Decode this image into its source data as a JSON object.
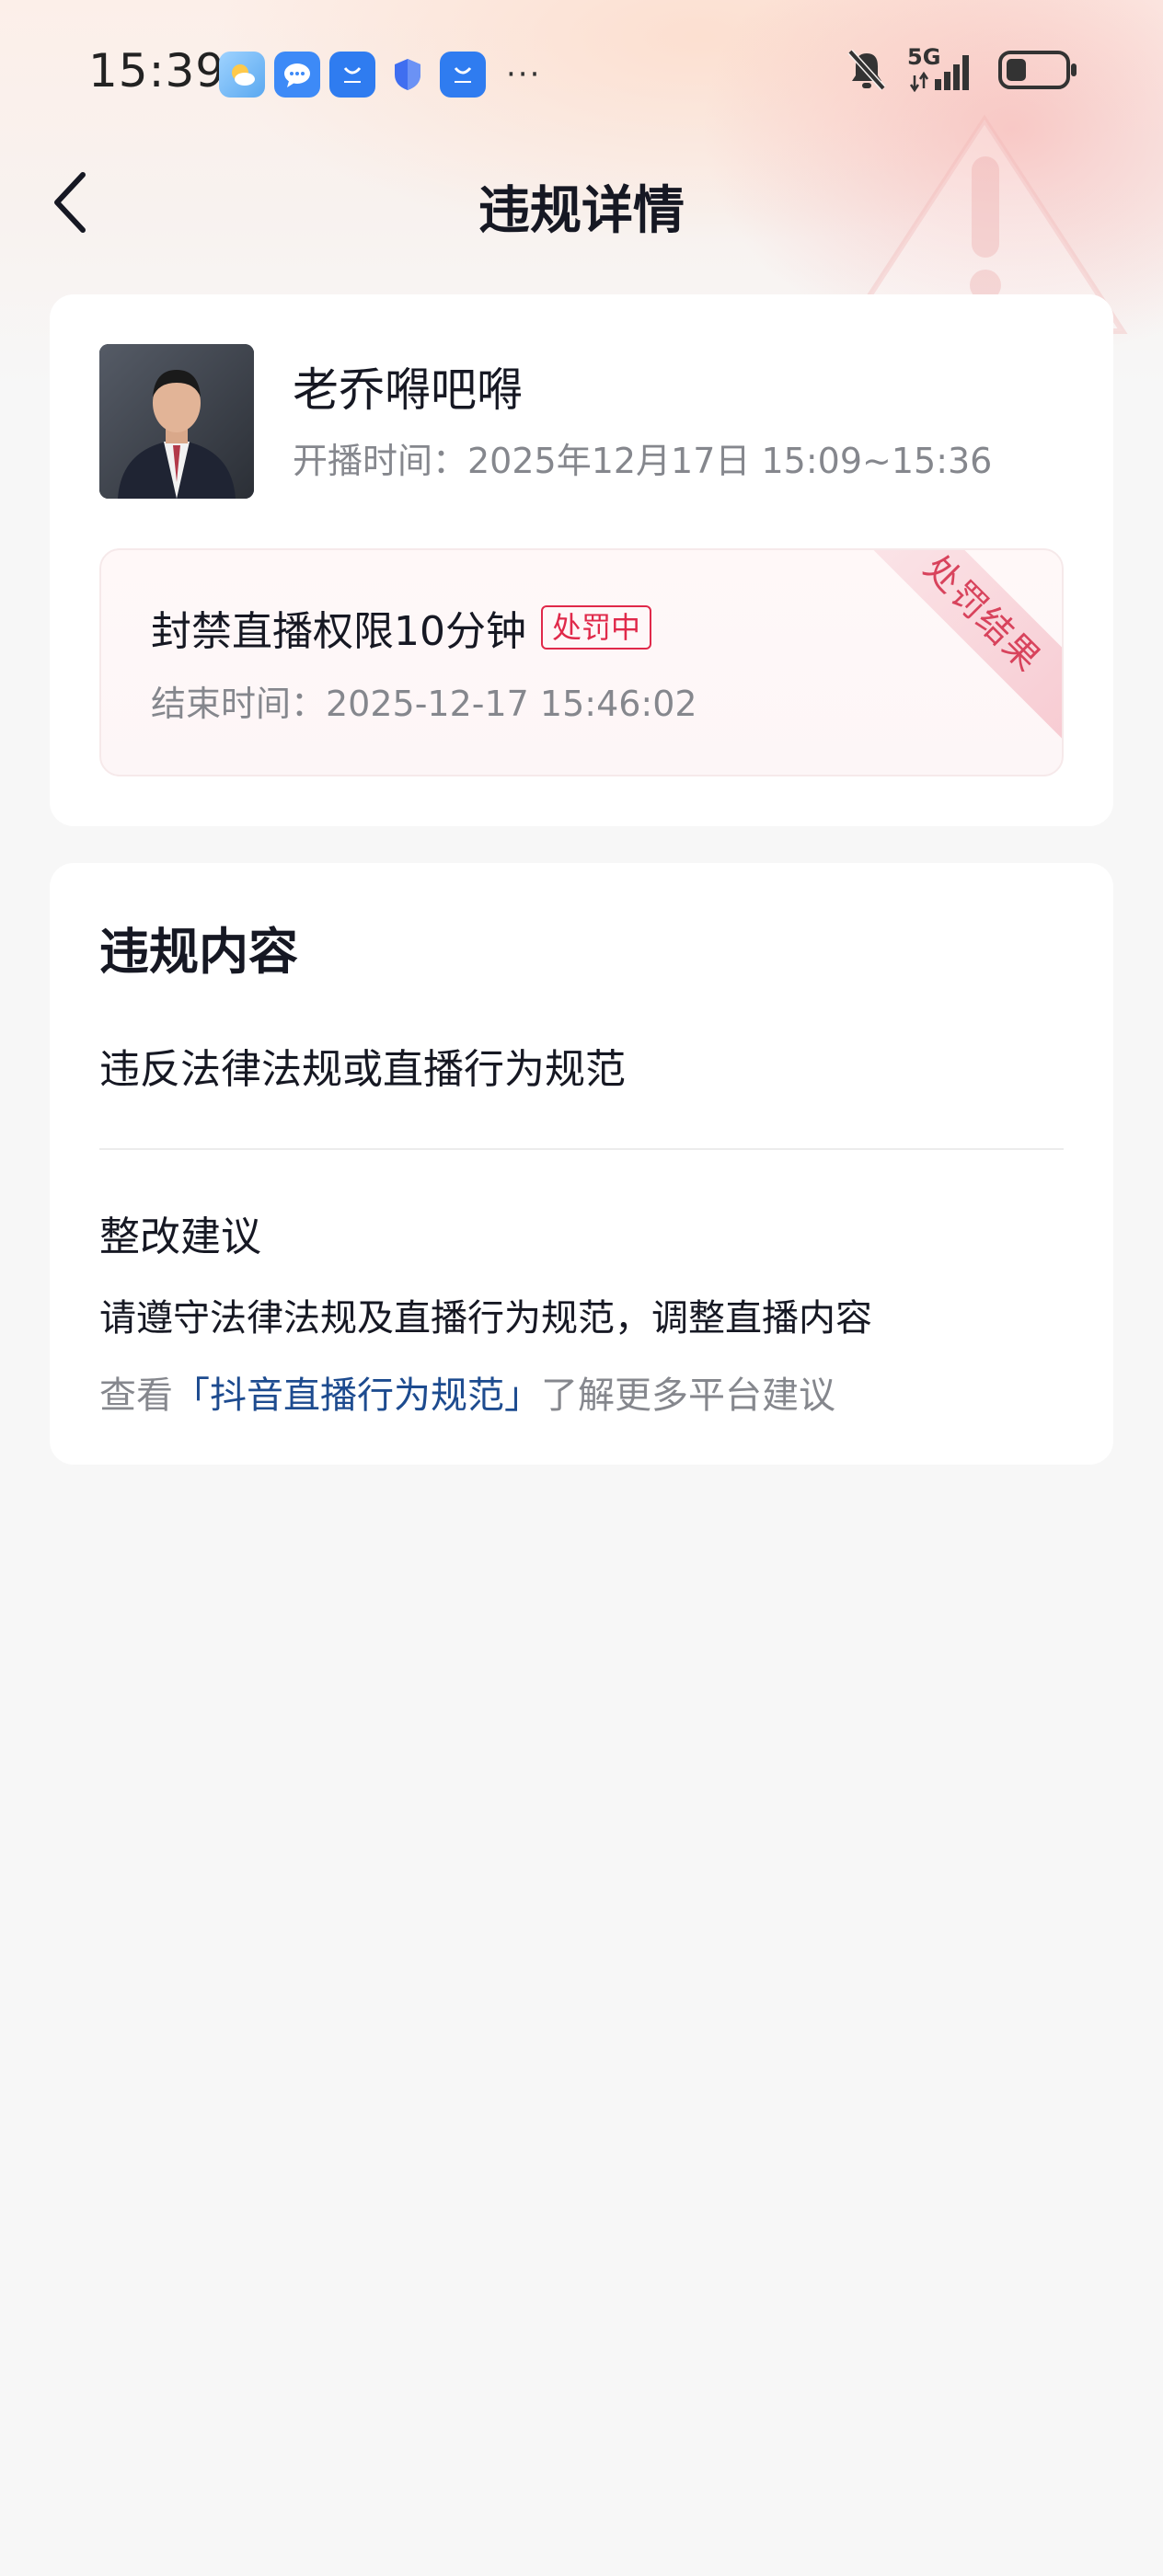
{
  "status_bar": {
    "time": "15:39",
    "notification_icons": [
      "weather-icon",
      "messages-icon",
      "honor-store-icon",
      "shield-icon",
      "honor-store-icon"
    ],
    "more": "···",
    "network": "5G",
    "battery_level": 0.35
  },
  "header": {
    "title": "违规详情",
    "back_icon": "chevron-left-icon"
  },
  "streamer": {
    "name": "老乔嘚吧嘚",
    "broadcast_time": "开播时间：2025年12月17日 15:09~15:36"
  },
  "penalty": {
    "title": "封禁直播权限10分钟",
    "status_badge": "处罚中",
    "end_time": "结束时间：2025-12-17 15:46:02",
    "ribbon": "处罚结果"
  },
  "violation": {
    "section_title": "违规内容",
    "content": "违反法律法规或直播行为规范",
    "advice_title": "整改建议",
    "advice_text": "请遵守法律法规及直播行为规范，调整直播内容",
    "guide_prefix": "查看",
    "guide_link": "「抖音直播行为规范」",
    "guide_suffix": "了解更多平台建议"
  },
  "colors": {
    "accent_red": "#e0294a",
    "link_blue": "#1d4b8f",
    "muted_text": "#85878d"
  }
}
